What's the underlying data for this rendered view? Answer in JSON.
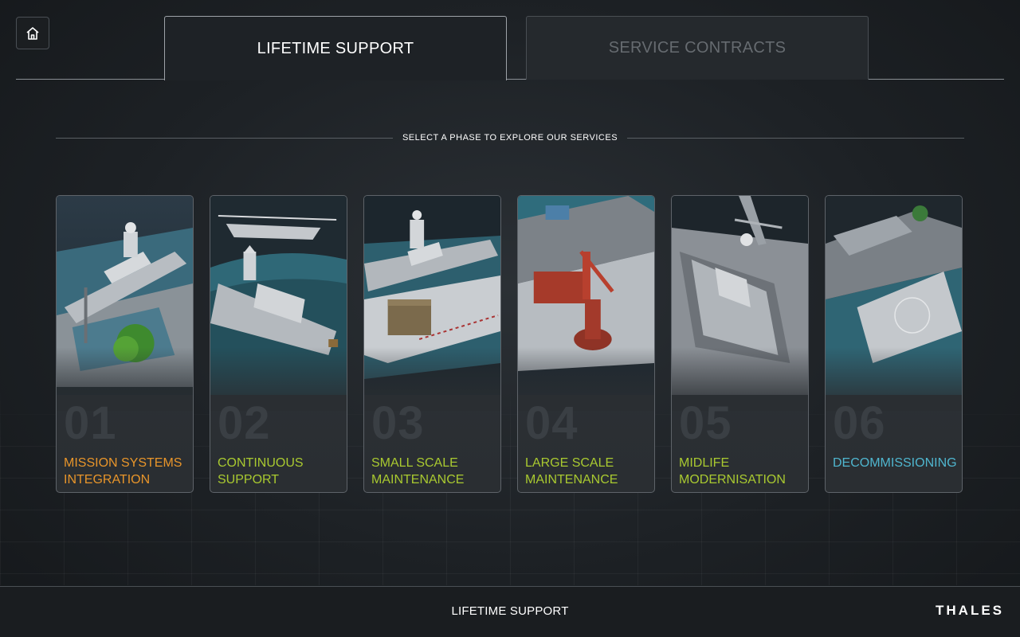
{
  "tabs": [
    {
      "label": "LIFETIME SUPPORT",
      "active": true
    },
    {
      "label": "SERVICE CONTRACTS",
      "active": false
    }
  ],
  "prompt": "SELECT A PHASE TO EXPLORE OUR SERVICES",
  "phases": [
    {
      "number": "01",
      "label": "MISSION SYSTEMS INTEGRATION",
      "color": "#e8952a",
      "scene": "frigate-at-quay-with-tree"
    },
    {
      "number": "02",
      "label": "CONTINUOUS SUPPORT",
      "color": "#a9c930",
      "scene": "frigate-with-helicopter"
    },
    {
      "number": "03",
      "label": "SMALL SCALE MAINTENANCE",
      "color": "#a9c930",
      "scene": "frigate-at-dock-with-crates"
    },
    {
      "number": "04",
      "label": "LARGE SCALE MAINTENANCE",
      "color": "#a9c930",
      "scene": "barge-with-red-crane"
    },
    {
      "number": "05",
      "label": "MIDLIFE MODERNISATION",
      "color": "#a9c930",
      "scene": "frigate-in-drydock"
    },
    {
      "number": "06",
      "label": "DECOMMISSIONING",
      "color": "#4fb6cf",
      "scene": "hulk-at-dismantling-yard"
    }
  ],
  "footer": {
    "title": "LIFETIME SUPPORT",
    "brand": "THALES"
  },
  "icons": {
    "home": "home-icon"
  }
}
